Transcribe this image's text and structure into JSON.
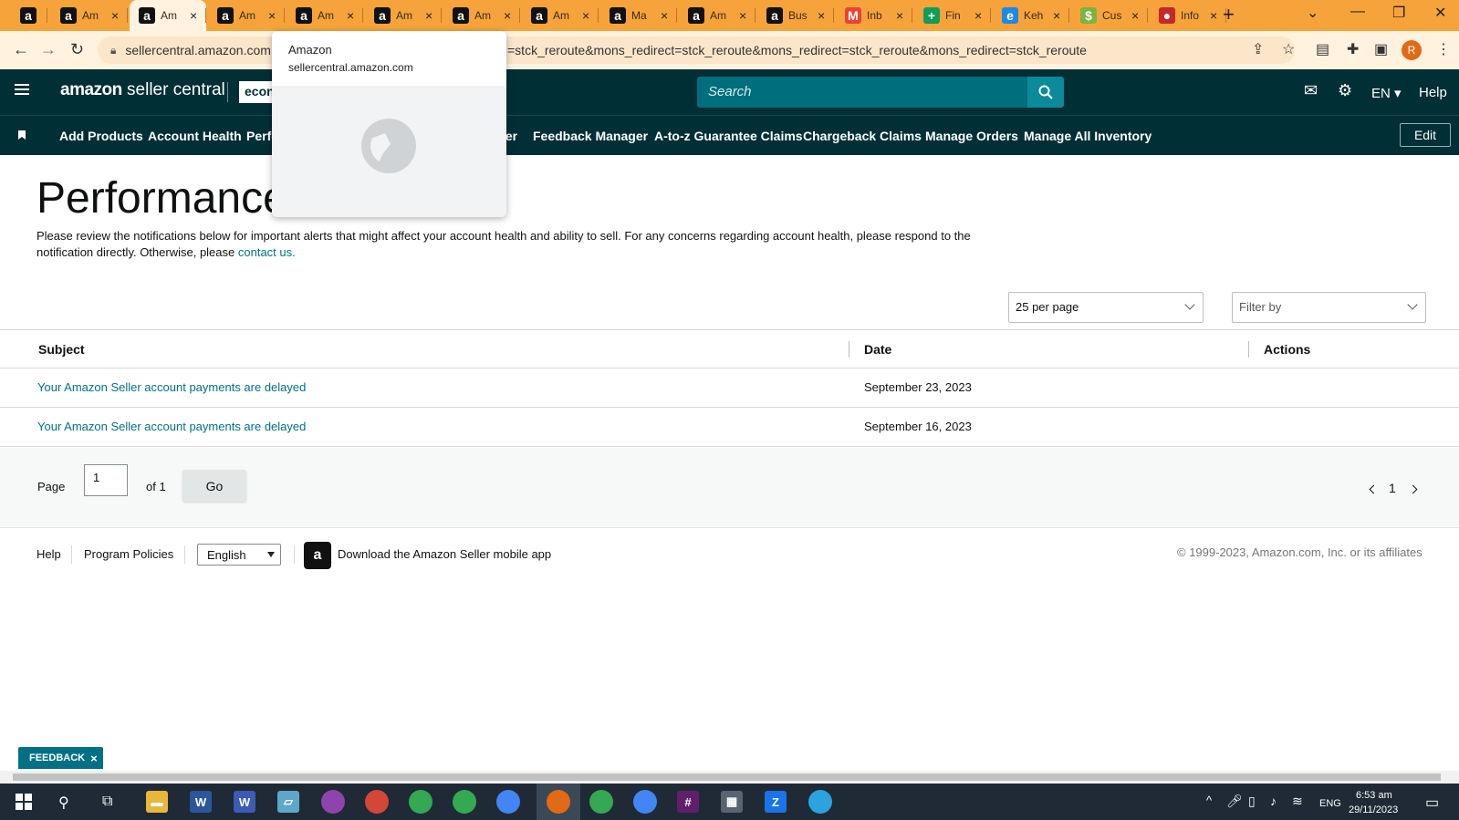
{
  "browser": {
    "tabs": [
      {
        "fav": "a",
        "title": "",
        "close": ""
      },
      {
        "fav": "a",
        "title": "Am",
        "close": "×"
      },
      {
        "fav": "a",
        "title": "Am",
        "close": "×"
      },
      {
        "fav": "a",
        "title": "Am",
        "close": "×"
      },
      {
        "fav": "a",
        "title": "Am",
        "close": "×"
      },
      {
        "fav": "a",
        "title": "Am",
        "close": "×"
      },
      {
        "fav": "a",
        "title": "Am",
        "close": "×"
      },
      {
        "fav": "a",
        "title": "Am",
        "close": "×"
      },
      {
        "fav": "a",
        "title": "Ma",
        "close": "×"
      },
      {
        "fav": "a",
        "title": "Am",
        "close": "×"
      },
      {
        "fav": "a",
        "title": "Bus",
        "close": "×"
      },
      {
        "fav": "M",
        "title": "Inb",
        "close": "×"
      },
      {
        "fav": "+",
        "title": "Fin",
        "close": "×"
      },
      {
        "fav": "e",
        "title": "Keh",
        "close": "×"
      },
      {
        "fav": "$",
        "title": "Cus",
        "close": "×"
      },
      {
        "fav": "●",
        "title": "Info",
        "close": "×"
      }
    ],
    "new_tab": "+",
    "url_host": "sellercentral.amazon.com",
    "url_rest": "=stck_reroute&mons_redirect=stck_reroute&mons_redirect=stck_reroute&mons_redirect=stck_reroute",
    "profile_initial": "R",
    "accent_color": "#f6a33b"
  },
  "tooltip": {
    "title": "Amazon",
    "subtitle": "sellercentral.amazon.com"
  },
  "header": {
    "brand_bold": "amazon",
    "brand_rest": " seller central",
    "store_label": "econ",
    "search_placeholder": "Search",
    "language": "EN",
    "help": "Help"
  },
  "nav": {
    "items": [
      "Add Products",
      "Account Health",
      "Perfo",
      "ler",
      "Feedback Manager",
      "A-to-z Guarantee Claims",
      "Chargeback Claims",
      "Manage Orders",
      "Manage All Inventory"
    ],
    "edit": "Edit"
  },
  "page": {
    "title": "Performance",
    "intro": "Please review the notifications below for important alerts that might affect your account health and ability to sell. For any concerns regarding account health, please respond to the notification directly. Otherwise, please ",
    "intro_link": "contact us.",
    "per_page": "25 per page",
    "filter": "Filter by"
  },
  "table": {
    "headers": [
      "Subject",
      "Date",
      "Actions"
    ],
    "rows": [
      {
        "subject": "Your Amazon Seller account payments are delayed",
        "date": "September 23, 2023"
      },
      {
        "subject": "Your Amazon Seller account payments are delayed",
        "date": "September 16, 2023"
      }
    ]
  },
  "pager": {
    "page_label": "Page",
    "page_value": "1",
    "of_label": "of 1",
    "go": "Go",
    "current": "1"
  },
  "footer": {
    "help": "Help",
    "policies": "Program Policies",
    "language": "English",
    "app_text": "Download the Amazon Seller mobile app",
    "copyright": "© 1999-2023, Amazon.com, Inc. or its affiliates"
  },
  "feedback": "FEEDBACK",
  "taskbar": {
    "language": "ENG",
    "time": "6:53 am",
    "date": "29/11/2023"
  }
}
